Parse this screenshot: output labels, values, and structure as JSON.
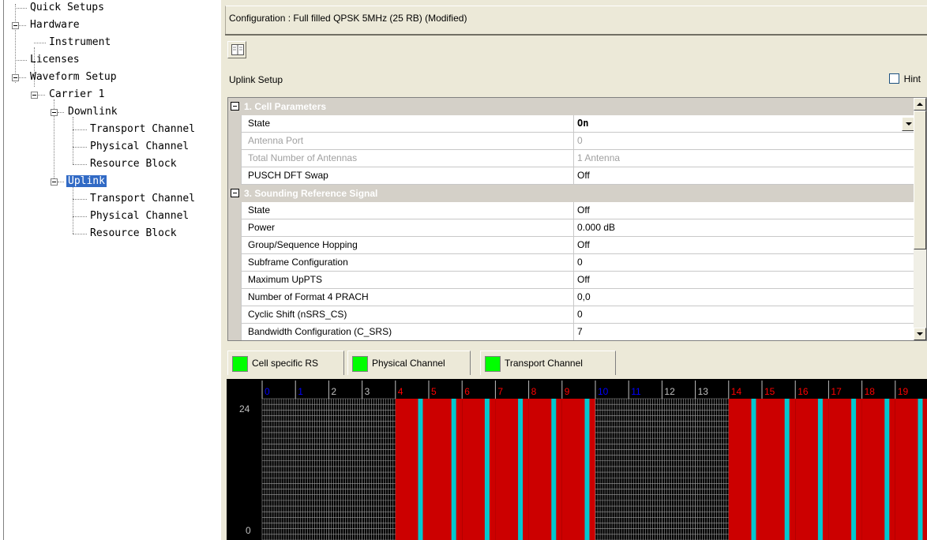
{
  "tree": {
    "items": [
      {
        "label": "Quick Setups"
      },
      {
        "label": "Hardware"
      },
      {
        "label": "Instrument"
      },
      {
        "label": "Licenses"
      },
      {
        "label": "Waveform Setup"
      },
      {
        "label": "Carrier 1"
      },
      {
        "label": "Downlink"
      },
      {
        "label": "Transport Channel"
      },
      {
        "label": "Physical Channel"
      },
      {
        "label": "Resource Block"
      },
      {
        "label": "Uplink"
      },
      {
        "label": "Transport Channel"
      },
      {
        "label": "Physical Channel"
      },
      {
        "label": "Resource Block"
      }
    ]
  },
  "config": {
    "text": "Configuration : Full filled QPSK 5MHz (25 RB) (Modified)"
  },
  "toolbar": {
    "icon": "book-icon"
  },
  "setup": {
    "title": "Uplink Setup",
    "hint_label": "Hint"
  },
  "grid": {
    "rows": [
      {
        "type": "category",
        "label": "1. Cell Parameters"
      },
      {
        "type": "prop",
        "name": "State",
        "value": "On",
        "state": "selected"
      },
      {
        "type": "prop",
        "name": "Antenna Port",
        "value": "0",
        "state": "disabled"
      },
      {
        "type": "prop",
        "name": "Total Number of Antennas",
        "value": "1 Antenna",
        "state": "disabled"
      },
      {
        "type": "prop",
        "name": "PUSCH DFT Swap",
        "value": "Off",
        "state": "normal"
      },
      {
        "type": "category",
        "label": "3. Sounding Reference Signal"
      },
      {
        "type": "prop",
        "name": "State",
        "value": "Off",
        "state": "normal"
      },
      {
        "type": "prop",
        "name": "Power",
        "value": "0.000 dB",
        "state": "normal"
      },
      {
        "type": "prop",
        "name": "Group/Sequence Hopping",
        "value": "Off",
        "state": "normal"
      },
      {
        "type": "prop",
        "name": "Subframe Configuration",
        "value": "0",
        "state": "normal"
      },
      {
        "type": "prop",
        "name": "Maximum UpPTS",
        "value": "Off",
        "state": "normal"
      },
      {
        "type": "prop",
        "name": "Number of Format 4 PRACH",
        "value": "0,0",
        "state": "normal"
      },
      {
        "type": "prop",
        "name": "Cyclic Shift (nSRS_CS)",
        "value": "0",
        "state": "normal"
      },
      {
        "type": "prop",
        "name": "Bandwidth Configuration (C_SRS)",
        "value": "7",
        "state": "normal"
      }
    ]
  },
  "legend": [
    {
      "label": "Cell specific RS",
      "color": "#00ff00"
    },
    {
      "label": "Physical Channel",
      "color": "#00ff00"
    },
    {
      "label": "Transport Channel",
      "color": "#00ff00"
    }
  ],
  "resource_grid": {
    "slots": [
      "0",
      "1",
      "2",
      "3",
      "4",
      "5",
      "6",
      "7",
      "8",
      "9",
      "10",
      "11",
      "12",
      "13",
      "14",
      "15",
      "16",
      "17",
      "18",
      "19"
    ],
    "slot_label_colors": [
      "#0000ff",
      "#0000ff",
      "#c0c0c0",
      "#c0c0c0",
      "#ff0000",
      "#ff0000",
      "#ff0000",
      "#ff0000",
      "#ff0000",
      "#ff0000",
      "#0000ff",
      "#0000ff",
      "#c0c0c0",
      "#c0c0c0",
      "#ff0000",
      "#ff0000",
      "#ff0000",
      "#ff0000",
      "#ff0000",
      "#ff0000"
    ],
    "filled_slots": [
      4,
      5,
      6,
      7,
      8,
      9,
      14,
      15,
      16,
      17,
      18,
      19
    ],
    "y_top_label": "24",
    "y_bottom_label": "0",
    "colors": {
      "fill": "#cc0000",
      "dmrs": "#00c8d0",
      "grid_line": "#a0a0a0",
      "empty": "#000000"
    }
  }
}
